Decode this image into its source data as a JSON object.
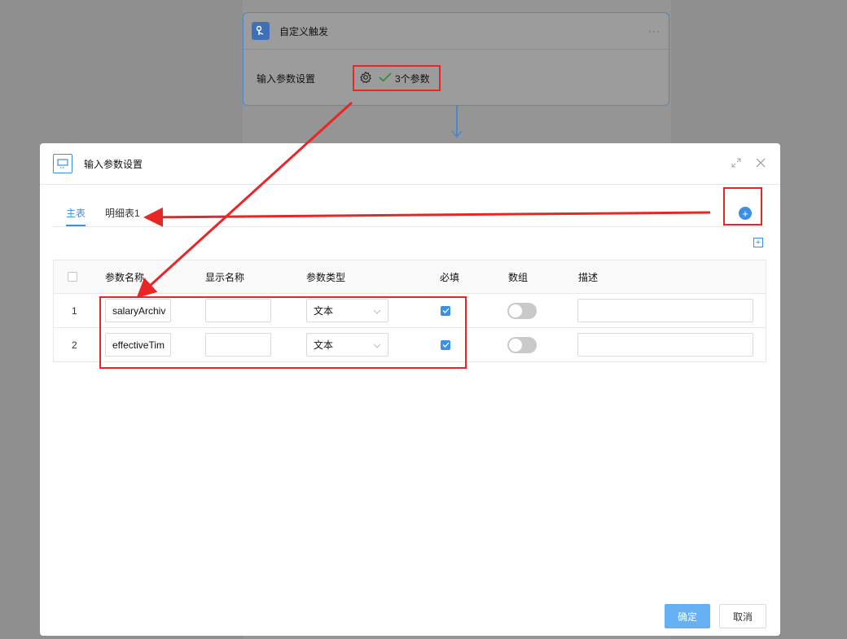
{
  "trigger": {
    "title": "自定义触发",
    "more": "···",
    "param_label": "输入参数设置",
    "param_count": "3个参数"
  },
  "modal": {
    "title": "输入参数设置",
    "tabs": [
      {
        "label": "主表",
        "active": true
      },
      {
        "label": "明细表1",
        "active": false
      }
    ],
    "add_tab_symbol": "+",
    "add_row_symbol": "+",
    "columns": [
      "参数名称",
      "显示名称",
      "参数类型",
      "必填",
      "数组",
      "描述"
    ],
    "rows": [
      {
        "index": "1",
        "name": "salaryArchiv",
        "display": "",
        "type": "文本",
        "required": true,
        "array": false,
        "desc": ""
      },
      {
        "index": "2",
        "name": "effectiveTim",
        "display": "",
        "type": "文本",
        "required": true,
        "array": false,
        "desc": ""
      }
    ],
    "confirm_label": "确定",
    "cancel_label": "取消"
  },
  "colors": {
    "accent": "#3b8fe6",
    "annotation": "#e82626",
    "overlay": "#8f8f8f"
  }
}
